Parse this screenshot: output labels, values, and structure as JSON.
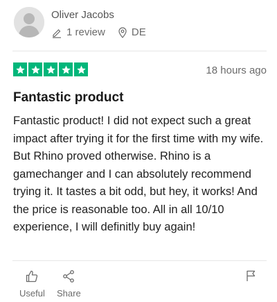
{
  "reviewer": {
    "name": "Oliver Jacobs",
    "review_count": "1 review",
    "country": "DE",
    "icons": {
      "reviews": "pencil-icon",
      "location": "location-pin-icon",
      "avatar": "user-silhouette-icon"
    }
  },
  "rating": {
    "stars": 5,
    "max_stars": 5,
    "star_color": "#00b67a",
    "time_ago": "18 hours ago"
  },
  "review": {
    "title": "Fantastic product",
    "body": "Fantastic product! I did not expect such a great impact after trying it for the first time with my wife. But Rhino proved otherwise. Rhino is a gamechanger and I can absolutely recommend trying it. It tastes a bit odd, but hey, it works! And the price is reasonable too. All in all 10/10 experience, I will definitly buy again!"
  },
  "actions": {
    "useful_label": "Useful",
    "share_label": "Share",
    "icons": {
      "useful": "thumbs-up-icon",
      "share": "share-icon",
      "report": "flag-icon"
    }
  }
}
